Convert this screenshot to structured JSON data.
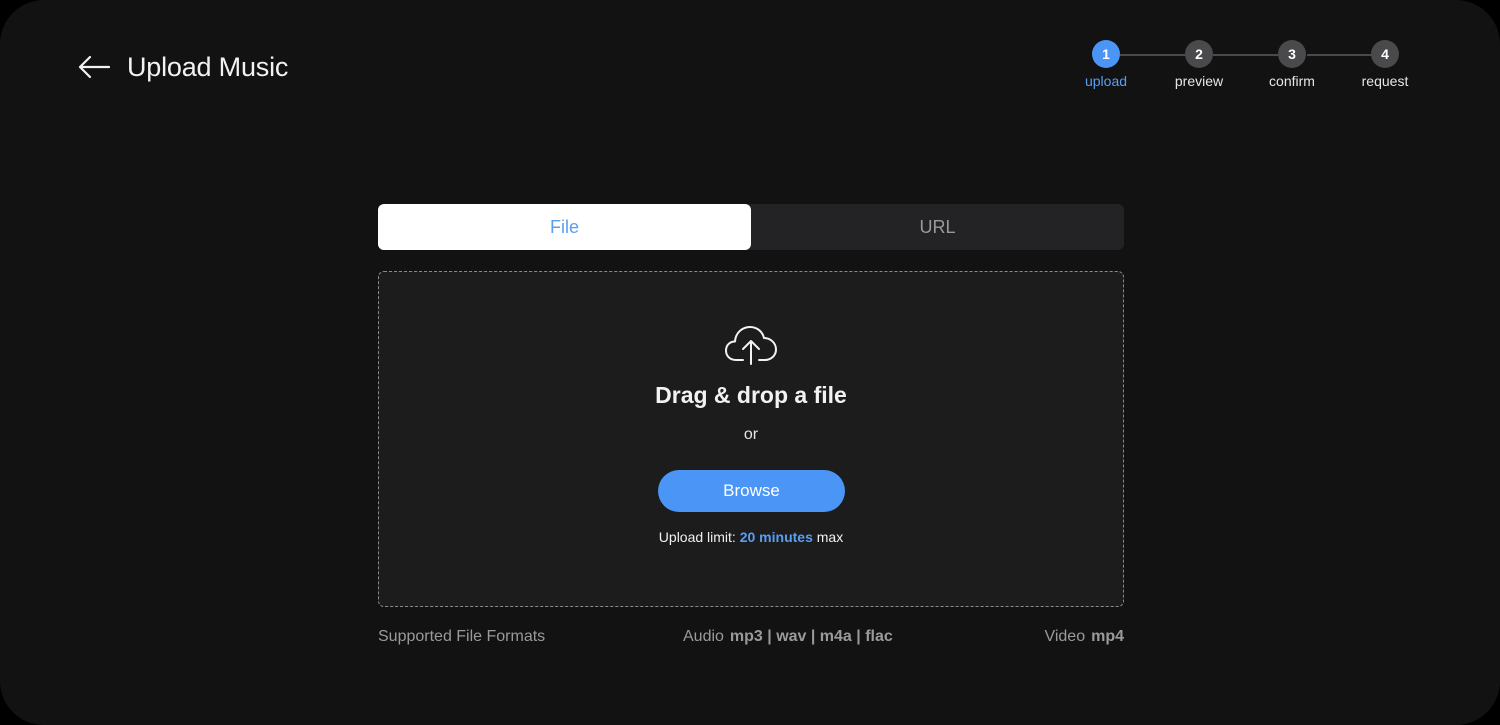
{
  "header": {
    "back_icon": "arrow-left-icon",
    "title": "Upload Music"
  },
  "stepper": {
    "current_step": 1,
    "steps": [
      {
        "number": "1",
        "label": "upload",
        "active": true
      },
      {
        "number": "2",
        "label": "preview",
        "active": false
      },
      {
        "number": "3",
        "label": "confirm",
        "active": false
      },
      {
        "number": "4",
        "label": "request",
        "active": false
      }
    ]
  },
  "tabs": [
    {
      "label": "File",
      "active": true
    },
    {
      "label": "URL",
      "active": false
    }
  ],
  "dropzone": {
    "icon": "cloud-upload-icon",
    "title": "Drag & drop a file",
    "or": "or",
    "browse_label": "Browse",
    "limit_prefix": "Upload limit:",
    "limit_value": "20 minutes",
    "limit_suffix": "max"
  },
  "formats": {
    "label": "Supported File Formats",
    "audio_label": "Audio",
    "audio_values": "mp3 | wav | m4a | flac",
    "video_label": "Video",
    "video_values": "mp4"
  },
  "colors": {
    "accent": "#4a95f5",
    "background": "#121213",
    "panel": "#1c1c1d",
    "inactive_step": "#4a4a4c"
  }
}
